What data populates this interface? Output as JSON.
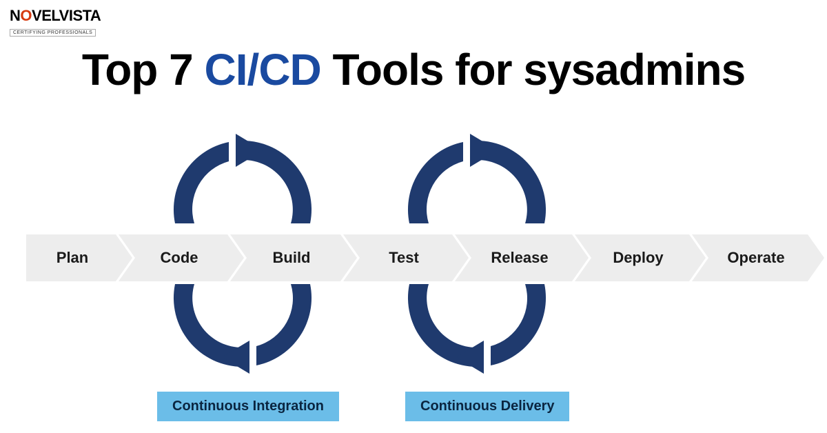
{
  "logo": {
    "text_prefix": "N",
    "text_accent": "O",
    "text_suffix": "VELVISTA",
    "subtitle": "CERTIFYING PROFESSIONALS"
  },
  "title": {
    "part1": "Top 7 ",
    "highlight": "CI/CD",
    "part2": " Tools for sysadmins"
  },
  "stages": {
    "s1": "Plan",
    "s2": "Code",
    "s3": "Build",
    "s4": "Test",
    "s5": "Release",
    "s6": "Deploy",
    "s7": "Operate"
  },
  "badges": {
    "ci": "Continuous Integration",
    "cd": "Continuous Delivery"
  },
  "colors": {
    "navy": "#1f3a6e",
    "badge_bg": "#6bbde8"
  }
}
